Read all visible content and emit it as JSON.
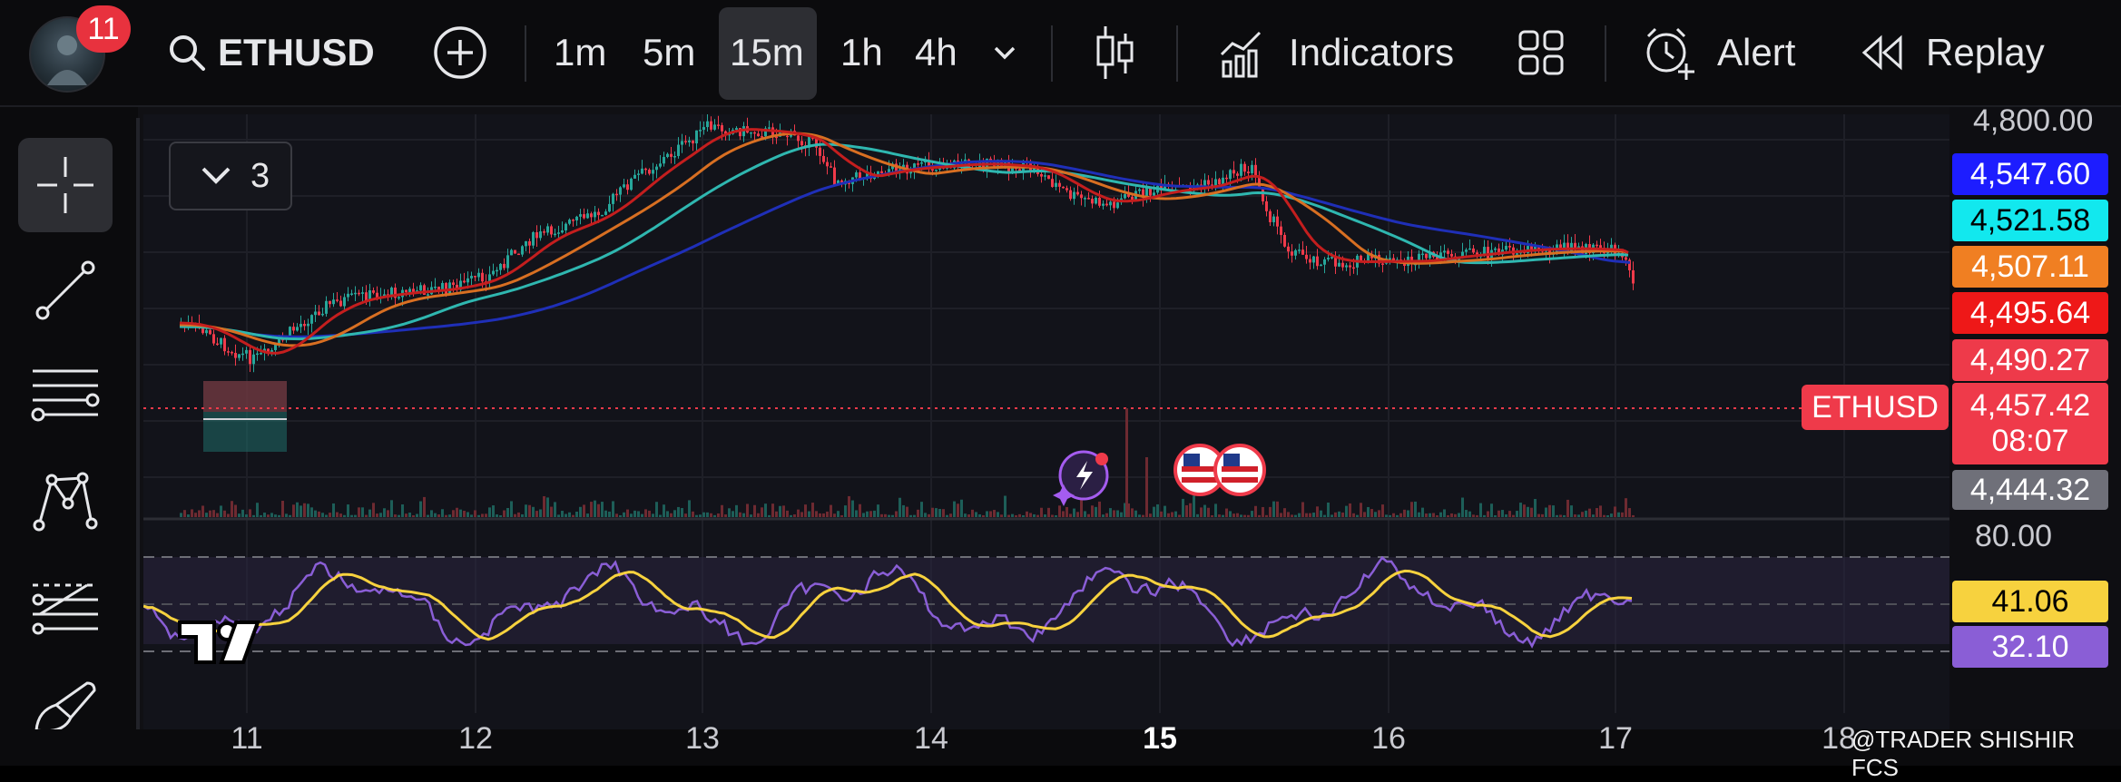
{
  "toolbar": {
    "notification_count": "11",
    "symbol": "ETHUSD",
    "timeframes": [
      "1m",
      "5m",
      "15m",
      "1h",
      "4h"
    ],
    "active_timeframe": "15m",
    "indicators_label": "Indicators",
    "alert_label": "Alert",
    "replay_label": "Replay"
  },
  "legend": {
    "count": "3"
  },
  "price_axis": {
    "top_label": "4,800.00",
    "ma_labels": [
      {
        "value": "4,547.60",
        "color": "#1d1dff",
        "text": "#ffffff"
      },
      {
        "value": "4,521.58",
        "color": "#12e8ee",
        "text": "#000000"
      },
      {
        "value": "4,507.11",
        "color": "#f07f22",
        "text": "#ffffff"
      },
      {
        "value": "4,495.64",
        "color": "#ee1818",
        "text": "#ffffff"
      },
      {
        "value": "4,490.27",
        "color": "#ee3a4a",
        "text": "#ffffff"
      }
    ],
    "current_price": "4,457.42",
    "countdown": "08:07",
    "last_label": "4,444.32",
    "symbol_tag": "ETHUSD"
  },
  "rsi_axis": {
    "level": "80.00",
    "ma_value": "41.06",
    "rsi_value": "32.10",
    "ma_color": "#f7d23e",
    "rsi_color": "#8a5ed6"
  },
  "time_axis": {
    "ticks": [
      "11",
      "12",
      "13",
      "14",
      "15",
      "16",
      "17",
      "18"
    ]
  },
  "watermark": "@TRADER SHISHIR FCS",
  "colors": {
    "up": "#26a69a",
    "down": "#ef3a4a",
    "ma_blue": "#1f2fb8",
    "ma_cyan": "#2fb7b0",
    "ma_orange": "#d86f22",
    "ma_red": "#c41e1e"
  }
}
